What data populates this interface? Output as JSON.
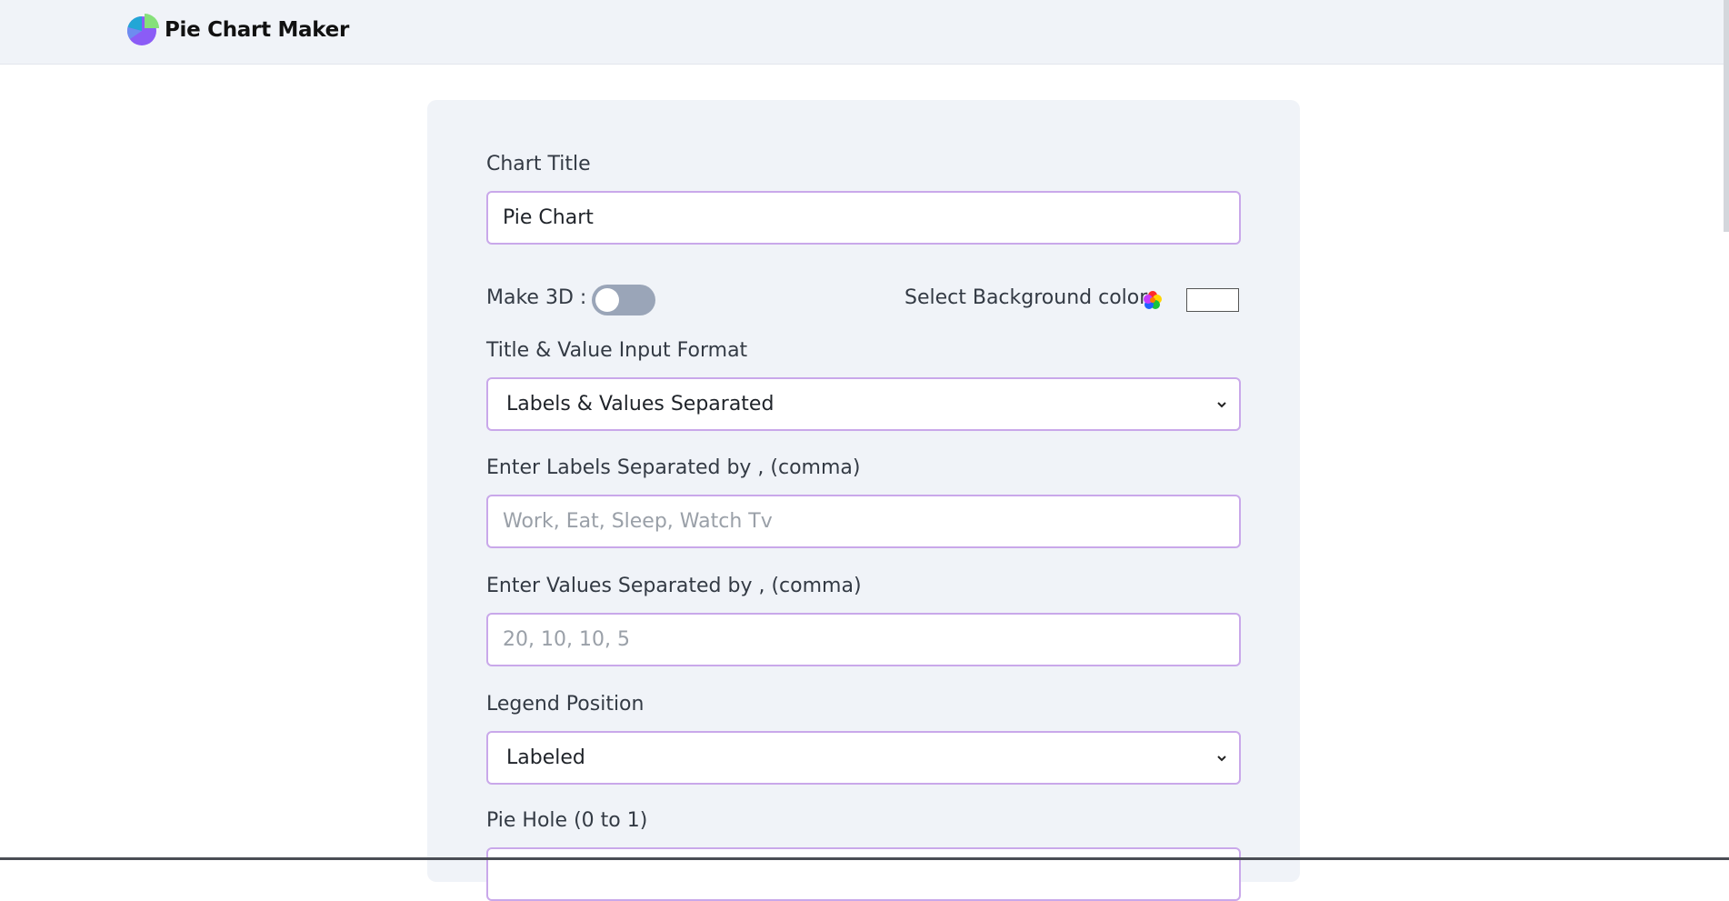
{
  "brand": {
    "name": "Pie Chart Maker",
    "icon": "pie-chart-logo-icon"
  },
  "form": {
    "chart_title": {
      "label": "Chart Title",
      "value": "Pie Chart"
    },
    "make_3d": {
      "label": "Make 3D :",
      "checked": false
    },
    "background": {
      "label": "Select Background color:",
      "value": "#ffffff",
      "icon": "color-palette-icon"
    },
    "input_format": {
      "label": "Title & Value Input Format",
      "selected": "Labels & Values Separated"
    },
    "labels": {
      "label": "Enter Labels Separated by , (comma)",
      "placeholder": "Work, Eat, Sleep, Watch Tv"
    },
    "values": {
      "label": "Enter Values Separated by , (comma)",
      "placeholder": "20, 10, 10, 5"
    },
    "legend_position": {
      "label": "Legend Position",
      "selected": "Labeled"
    },
    "pie_hole": {
      "label": "Pie Hole (0 to 1)"
    }
  },
  "colors": {
    "accent_border": "#c9a8ea",
    "toggle_off": "#9aa5b8",
    "panel_bg": "#f0f3f8"
  }
}
